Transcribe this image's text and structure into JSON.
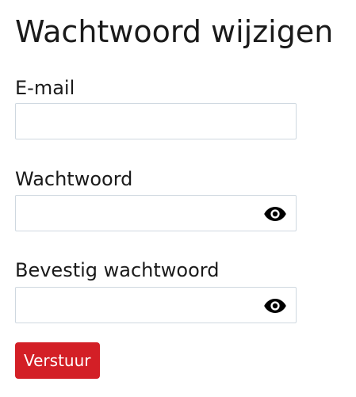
{
  "form": {
    "title": "Wachtwoord wijzigen",
    "email": {
      "label": "E-mail",
      "value": "",
      "placeholder": ""
    },
    "password": {
      "label": "Wachtwoord",
      "value": "",
      "placeholder": "",
      "toggle_icon": "eye-icon"
    },
    "confirm_password": {
      "label": "Bevestig wachtwoord",
      "value": "",
      "placeholder": "",
      "toggle_icon": "eye-icon"
    },
    "submit_label": "Verstuur"
  },
  "colors": {
    "accent": "#d31f26",
    "text": "#1a1a1a",
    "input_border": "#cfd8e0",
    "background": "#ffffff"
  }
}
